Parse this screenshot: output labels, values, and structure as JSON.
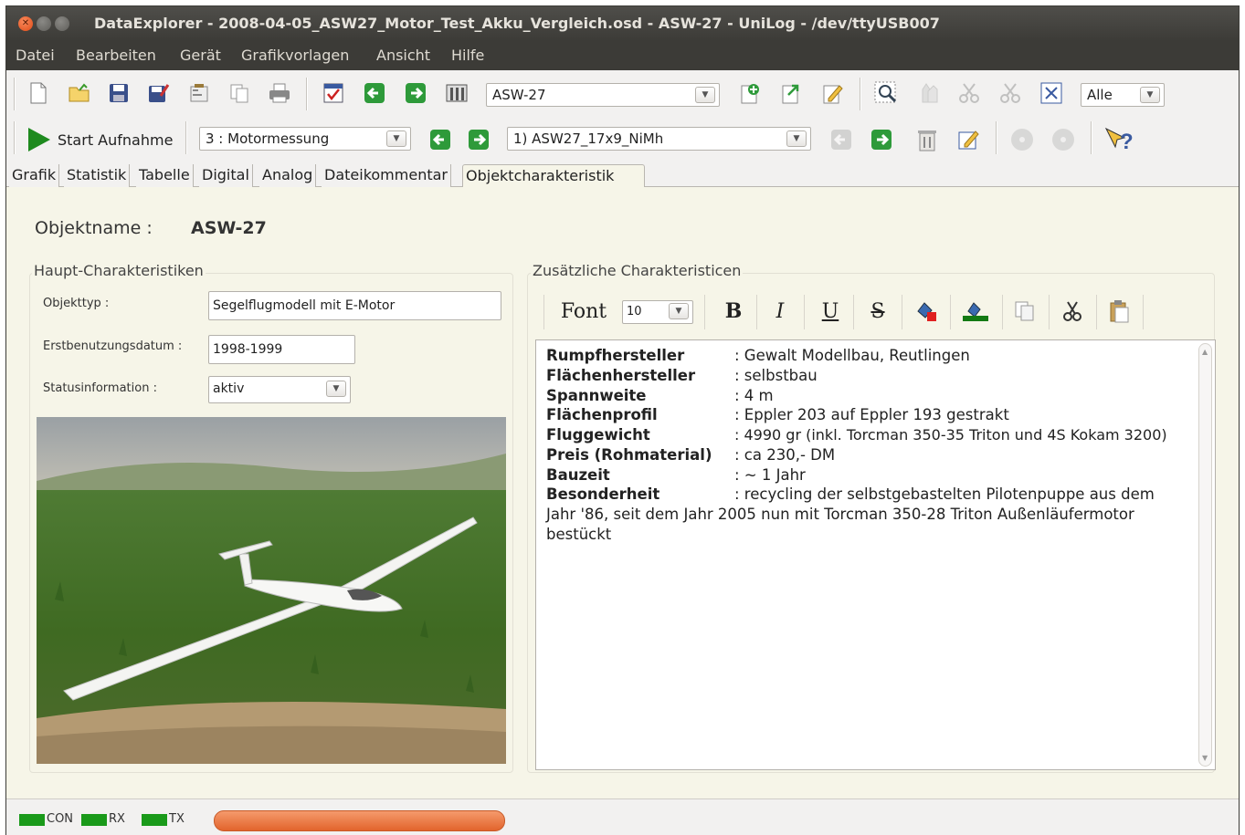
{
  "window": {
    "title": "DataExplorer - 2008-04-05_ASW27_Motor_Test_Akku_Vergleich.osd - ASW-27 - UniLog - /dev/ttyUSB007"
  },
  "menubar": [
    "Datei",
    "Bearbeiten",
    "Gerät",
    "Grafikvorlagen",
    "Ansicht",
    "Hilfe"
  ],
  "toolbar1": {
    "object_combo": "ASW-27",
    "scope_combo": "Alle",
    "icons": [
      "new-file-icon",
      "open-folder-icon",
      "save-icon",
      "save-as-icon",
      "properties-icon",
      "copy-icon",
      "print-icon",
      "checklist-icon",
      "arrow-left-icon",
      "arrow-right-icon",
      "object-settings-icon",
      "add-object-icon",
      "export-object-icon",
      "edit-object-icon",
      "zoom-icon",
      "pan-icon",
      "cut-graph-icon",
      "cut-graph2-icon",
      "fit-icon"
    ]
  },
  "toolbar2": {
    "start_label": "Start Aufnahme",
    "device_combo": "3 : Motormessung",
    "record_combo": "1) ASW27_17x9_NiMh"
  },
  "tabs": [
    "Grafik",
    "Statistik",
    "Tabelle",
    "Digital",
    "Analog",
    "Dateikommentar",
    "Objektcharakteristik"
  ],
  "active_tab": "Objektcharakteristik",
  "object": {
    "name_label": "Objektname :",
    "name_value": "ASW-27"
  },
  "main_group": {
    "title": "Haupt-Charakteristiken",
    "fields": {
      "type_label": "Objekttyp :",
      "type_value": "Segelflugmodell mit E-Motor",
      "date_label": "Erstbenutzungsdatum :",
      "date_value": "1998-1999",
      "status_label": "Statusinformation :",
      "status_value": "aktiv"
    }
  },
  "extra_group": {
    "title": "Zusätzliche Charakteristicen",
    "editor_toolbar": {
      "font_label": "Font",
      "font_size": "10",
      "bold": "B",
      "italic": "I",
      "underline": "U",
      "strike": "S"
    },
    "rows": [
      {
        "key": "Rumpfhersteller",
        "value": ": Gewalt Modellbau, Reutlingen"
      },
      {
        "key": "Flächenhersteller",
        "value": ": selbstbau"
      },
      {
        "key": "Spannweite",
        "value": ": 4 m"
      },
      {
        "key": "Flächenprofil",
        "value": ": Eppler 203 auf Eppler 193 gestrakt"
      },
      {
        "key": "Fluggewicht",
        "value": ": 4990 gr (inkl. Torcman 350-35 Triton und 4S Kokam 3200)"
      },
      {
        "key": "Preis (Rohmaterial)",
        "value": ": ca 230,- DM"
      },
      {
        "key": "Bauzeit",
        "value": ": ~ 1 Jahr"
      },
      {
        "key": "Besonderheit",
        "value": ": recycling der selbstgebastelten Pilotenpuppe aus dem"
      }
    ],
    "continuation": "Jahr '86, seit dem Jahr 2005 nun mit Torcman 350-28 Triton Außenläufermotor bestückt"
  },
  "statusbar": {
    "leds": [
      "CON",
      "RX",
      "TX"
    ],
    "led_color": "#1a9a1a",
    "progress_color": "#e8723a"
  }
}
